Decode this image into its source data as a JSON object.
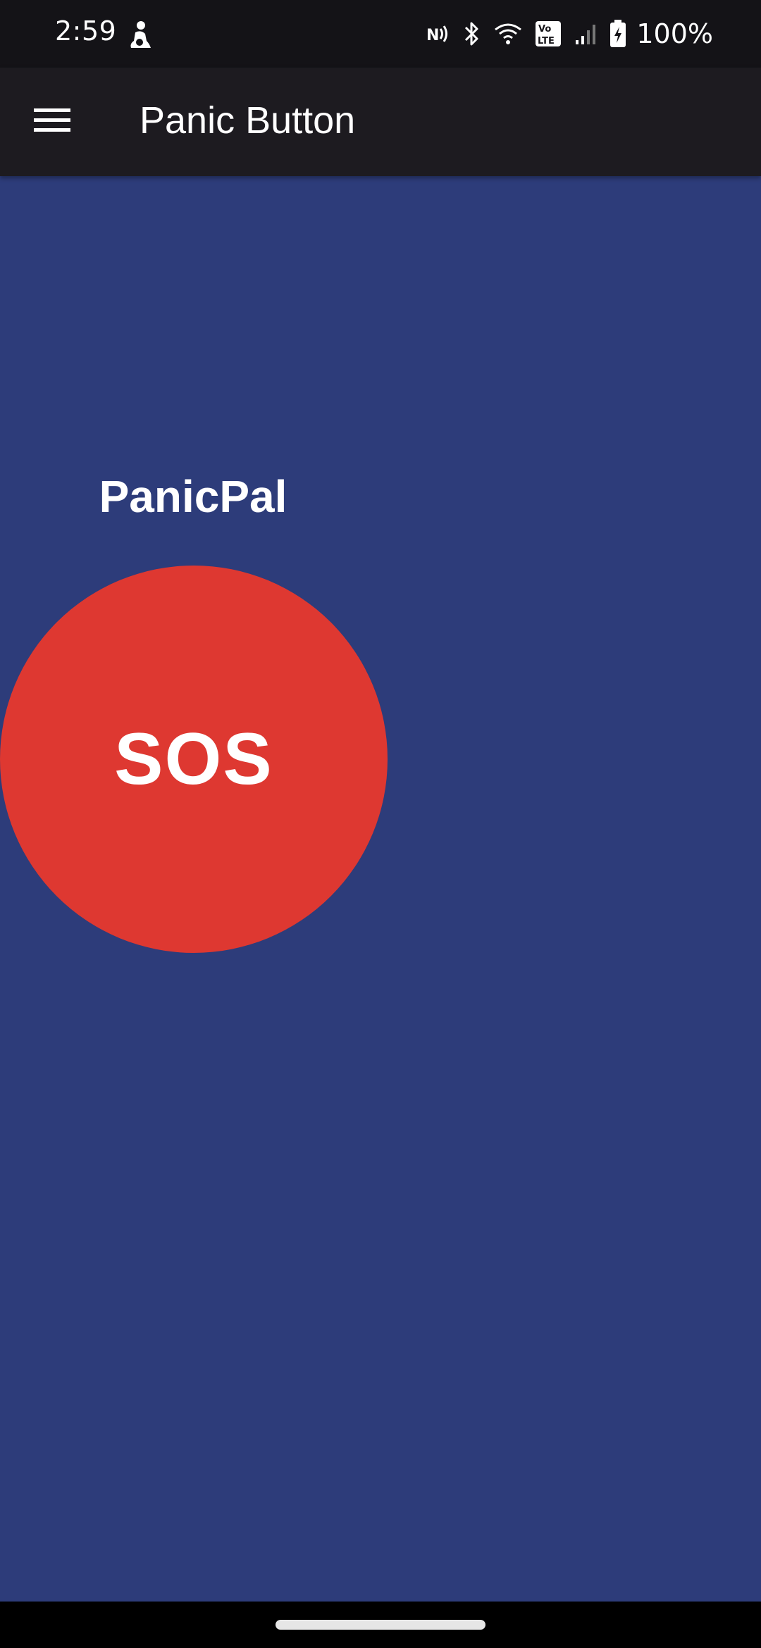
{
  "status_bar": {
    "time": "2:59",
    "battery": "100%",
    "icons": [
      "nfc-icon",
      "bluetooth-icon",
      "wifi-icon",
      "volte-icon",
      "signal-icon",
      "battery-charging-icon"
    ],
    "notification_icon": "person-icon"
  },
  "app_bar": {
    "title": "Panic Button",
    "menu_icon": "hamburger-menu-icon"
  },
  "main": {
    "brand_title": "PanicPal",
    "sos_label": "SOS"
  },
  "colors": {
    "background": "#2d3c7a",
    "app_bar": "#1d1b20",
    "status_bar": "#141317",
    "sos_button": "#de3831",
    "text": "#ffffff"
  }
}
